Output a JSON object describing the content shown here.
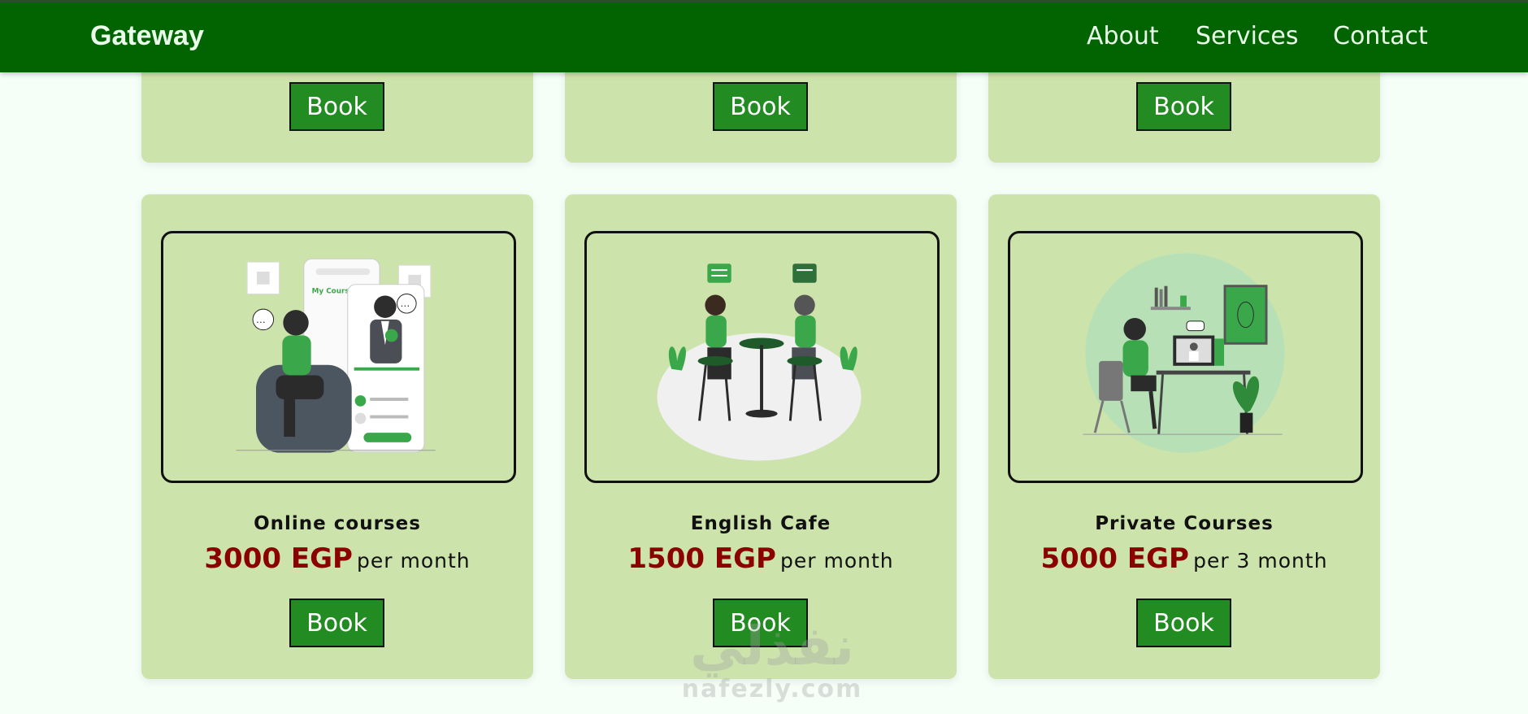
{
  "navbar": {
    "brand": "Gateway",
    "links": [
      "About",
      "Services",
      "Contact"
    ]
  },
  "top_row": {
    "book_labels": [
      "Book",
      "Book",
      "Book"
    ]
  },
  "cards": [
    {
      "title": "Online courses",
      "price": "3000 EGP",
      "period": "per month",
      "book_label": "Book"
    },
    {
      "title": "English Cafe",
      "price": "1500 EGP",
      "period": "per month",
      "book_label": "Book"
    },
    {
      "title": "Private Courses",
      "price": "5000 EGP",
      "period": "per 3 month",
      "book_label": "Book"
    }
  ],
  "watermark": {
    "arabic": "نفذلي",
    "latin": "nafezly.com"
  },
  "colors": {
    "navbar": "#016401",
    "card_bg": "#cce4ac",
    "button": "#228b22",
    "price": "#8b0000",
    "accent_green": "#3aa84a"
  }
}
